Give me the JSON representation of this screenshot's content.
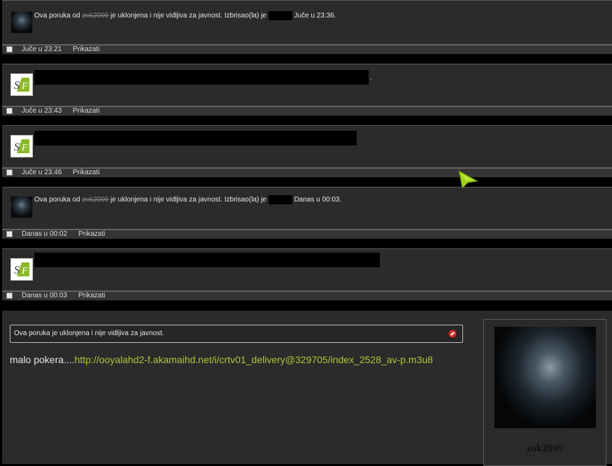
{
  "posts": [
    {
      "kind": "deleted",
      "note": {
        "prefix": "Ova poruka od",
        "author": "zok2009",
        "middle": "je uklonjena i nije vidljiva za javnost. Izbrisao(la) je",
        "when": "Juče u 23:36."
      },
      "footer": {
        "time": "Juče u 23:21",
        "show": "Prikazati"
      }
    },
    {
      "kind": "redacted",
      "trailing": ".",
      "footer": {
        "time": "Juče u 23:43",
        "show": "Prikazati"
      }
    },
    {
      "kind": "redacted",
      "footer": {
        "time": "Juče u 23:46",
        "show": "Prikazati"
      }
    },
    {
      "kind": "deleted",
      "note": {
        "prefix": "Ova poruka od",
        "author": "zok2009",
        "middle": "je uklonjena i nije vidljiva za javnost. Izbrisao(la) je",
        "when": "Danas u 00:03."
      },
      "footer": {
        "time": "Danas u 00:02",
        "show": "Prikazati"
      }
    },
    {
      "kind": "redacted",
      "footer": {
        "time": "Danas u 00:03",
        "show": "Prikazati"
      }
    }
  ],
  "last_post": {
    "notice": "Ova poruka je uklonjena i nije vidljiva za javnost.",
    "message_prefix": "malo pokera....",
    "link": "http://ooyalahd2-f.akamaihd.net/i/crtv01_delivery@329705/index_2528_av-p.m3u8",
    "username": "zok2009"
  },
  "icons": {
    "avatar_vampire": "vampire-avatar",
    "avatar_sf": "sf-logo",
    "notice_icon": "stop-icon",
    "cursor": "cursor-arrow-icon"
  },
  "colors": {
    "link": "#b8c23a",
    "background": "#2b2b2b",
    "cursor": "#9fd21a"
  }
}
